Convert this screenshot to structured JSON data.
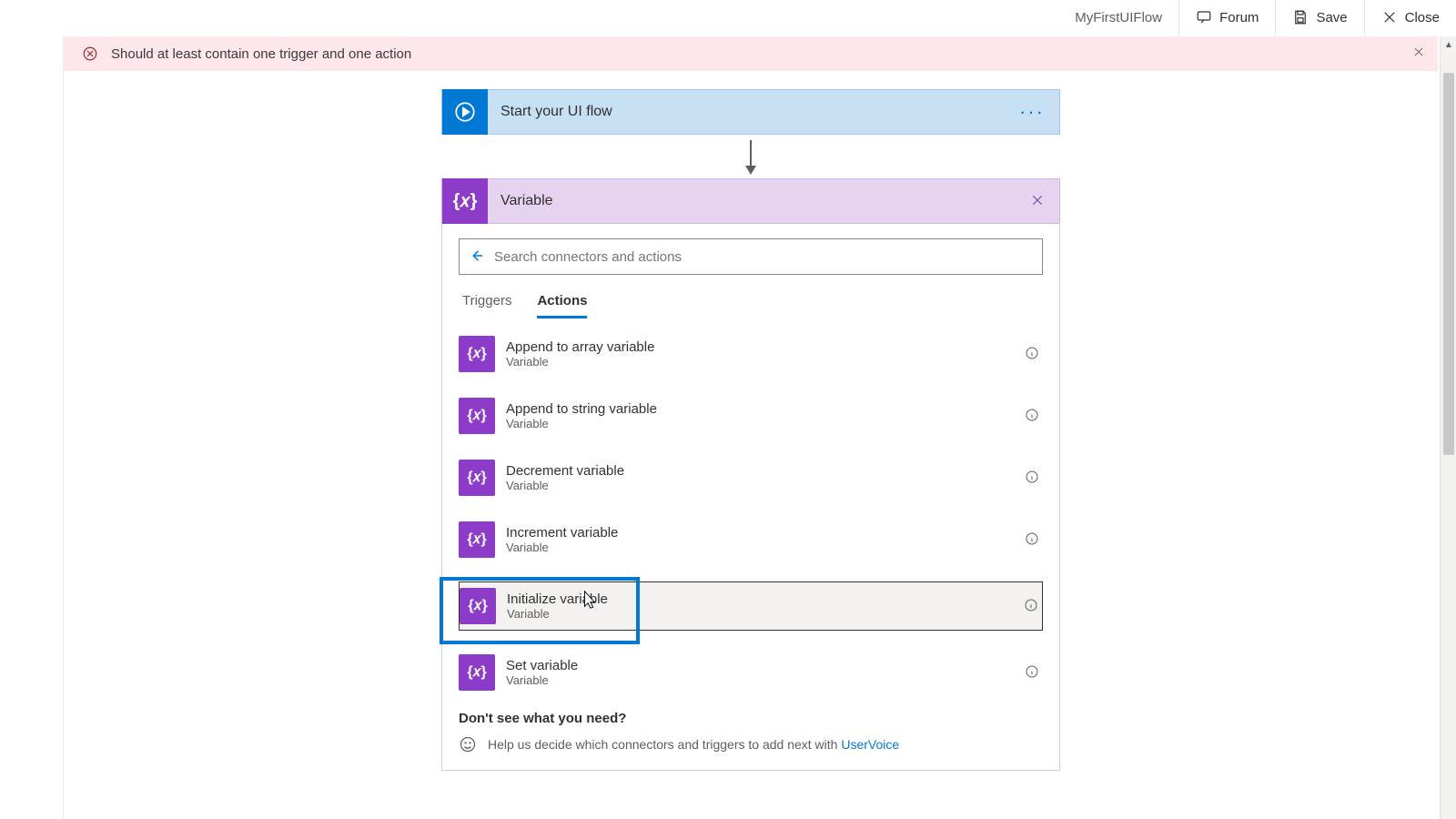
{
  "topbar": {
    "flowName": "MyFirstUIFlow",
    "forum": "Forum",
    "save": "Save",
    "close": "Close"
  },
  "alert": {
    "message": "Should at least contain one trigger and one action"
  },
  "startCard": {
    "title": "Start your UI flow"
  },
  "variablePanel": {
    "title": "Variable",
    "searchPlaceholder": "Search connectors and actions",
    "tabs": {
      "triggers": "Triggers",
      "actions": "Actions"
    },
    "actions": [
      {
        "name": "Append to array variable",
        "sub": "Variable"
      },
      {
        "name": "Append to string variable",
        "sub": "Variable"
      },
      {
        "name": "Decrement variable",
        "sub": "Variable"
      },
      {
        "name": "Increment variable",
        "sub": "Variable"
      },
      {
        "name": "Initialize variable",
        "sub": "Variable"
      },
      {
        "name": "Set variable",
        "sub": "Variable"
      }
    ],
    "help": {
      "title": "Don't see what you need?",
      "body": "Help us decide which connectors and triggers to add next with ",
      "link": "UserVoice"
    }
  }
}
